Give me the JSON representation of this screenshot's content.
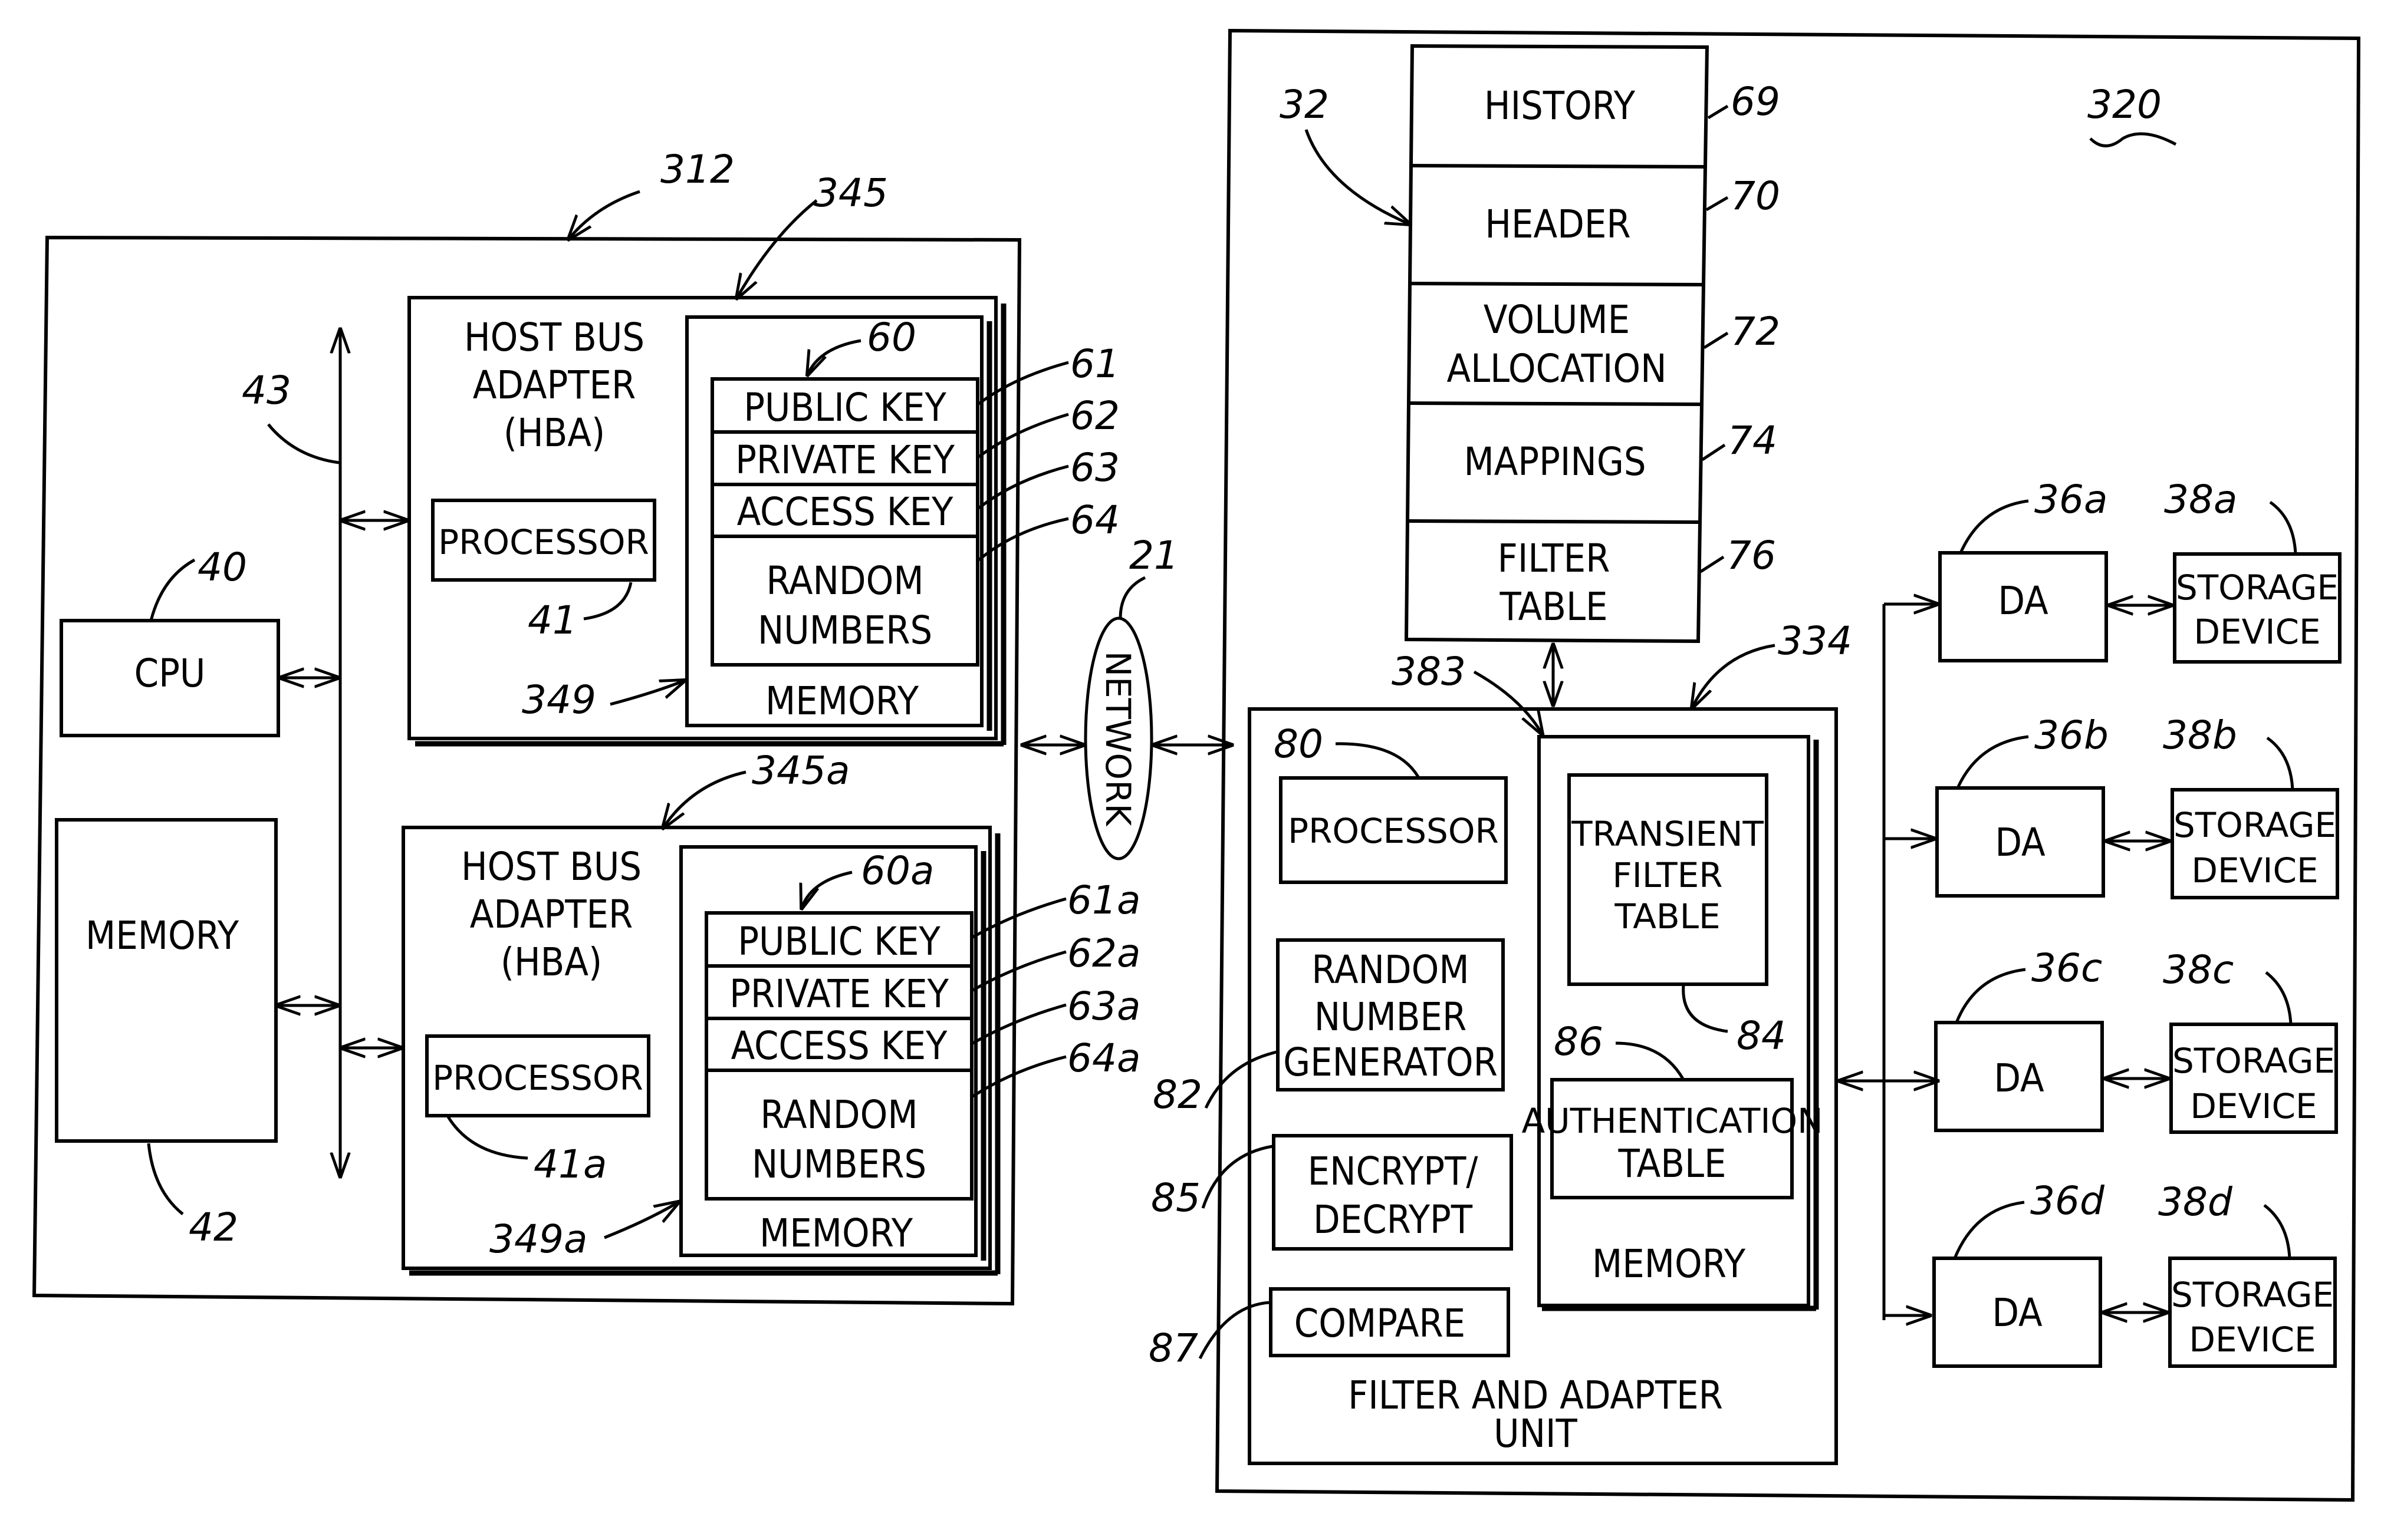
{
  "host": {
    "ref": "312",
    "bus_ref": "43",
    "cpu": {
      "label": "CPU",
      "ref": "40"
    },
    "memory": {
      "label": "MEMORY",
      "ref": "42"
    },
    "hba": [
      {
        "ref": "345",
        "title_lines": [
          "HOST BUS",
          "ADAPTER",
          "(HBA)"
        ],
        "processor": {
          "label": "PROCESSOR",
          "ref": "41"
        },
        "memory": {
          "label": "MEMORY",
          "ref": "349"
        },
        "keys_ref": "60",
        "fields": [
          {
            "label": "PUBLIC KEY",
            "ref": "61"
          },
          {
            "label": "PRIVATE KEY",
            "ref": "62"
          },
          {
            "label": "ACCESS KEY",
            "ref": "63"
          },
          {
            "label_lines": [
              "RANDOM",
              "NUMBERS"
            ],
            "ref": "64"
          }
        ]
      },
      {
        "ref": "345a",
        "title_lines": [
          "HOST BUS",
          "ADAPTER",
          "(HBA)"
        ],
        "processor": {
          "label": "PROCESSOR",
          "ref": "41a"
        },
        "memory": {
          "label": "MEMORY",
          "ref": "349a"
        },
        "keys_ref": "60a",
        "fields": [
          {
            "label": "PUBLIC KEY",
            "ref": "61a"
          },
          {
            "label": "PRIVATE KEY",
            "ref": "62a"
          },
          {
            "label": "ACCESS KEY",
            "ref": "63a"
          },
          {
            "label_lines": [
              "RANDOM",
              "NUMBERS"
            ],
            "ref": "64a"
          }
        ]
      }
    ]
  },
  "network": {
    "label": "NETWORK",
    "ref": "21"
  },
  "storage_system": {
    "ref": "320",
    "config_ref": "32",
    "config_rows": [
      {
        "lines": [
          "HISTORY"
        ],
        "ref": "69"
      },
      {
        "lines": [
          "HEADER"
        ],
        "ref": "70"
      },
      {
        "lines": [
          "VOLUME",
          "ALLOCATION"
        ],
        "ref": "72"
      },
      {
        "lines": [
          "MAPPINGS"
        ],
        "ref": "74"
      },
      {
        "lines": [
          "FILTER",
          "TABLE"
        ],
        "ref": "76"
      }
    ],
    "fau": {
      "ref": "334",
      "title_lines": [
        "FILTER AND ADAPTER",
        "UNIT"
      ],
      "processor": {
        "label": "PROCESSOR",
        "ref": "80"
      },
      "rng": {
        "lines": [
          "RANDOM",
          "NUMBER",
          "GENERATOR"
        ],
        "ref": "82"
      },
      "crypt": {
        "lines": [
          "ENCRYPT/",
          "DECRYPT"
        ],
        "ref": "85"
      },
      "compare": {
        "label": "COMPARE",
        "ref": "87"
      },
      "memory": {
        "label": "MEMORY",
        "ref": "383",
        "transient": {
          "lines": [
            "TRANSIENT",
            "FILTER",
            "TABLE"
          ],
          "ref": "84"
        },
        "auth": {
          "lines": [
            "AUTHENTICATION",
            "TABLE"
          ],
          "ref": "86"
        }
      }
    },
    "disk_adapters": [
      {
        "label": "DA",
        "ref": "36a",
        "storage_lines": [
          "STORAGE",
          "DEVICE"
        ],
        "storage_ref": "38a"
      },
      {
        "label": "DA",
        "ref": "36b",
        "storage_lines": [
          "STORAGE",
          "DEVICE"
        ],
        "storage_ref": "38b"
      },
      {
        "label": "DA",
        "ref": "36c",
        "storage_lines": [
          "STORAGE",
          "DEVICE"
        ],
        "storage_ref": "38c"
      },
      {
        "label": "DA",
        "ref": "36d",
        "storage_lines": [
          "STORAGE",
          "DEVICE"
        ],
        "storage_ref": "38d"
      }
    ]
  }
}
